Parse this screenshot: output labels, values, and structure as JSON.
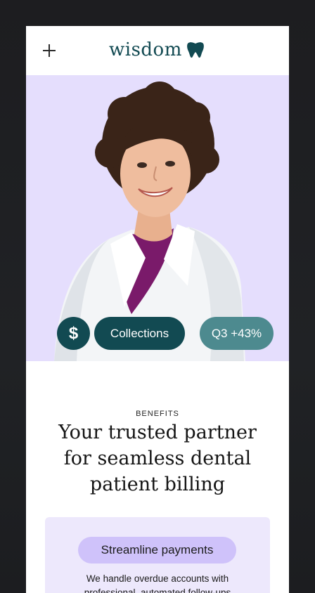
{
  "header": {
    "logo_text": "wisdom",
    "menu_icon": "plus-icon",
    "brand_color": "#124a52"
  },
  "hero": {
    "background": "#e5defd",
    "badge_icon_glyph": "$",
    "collections_label": "Collections",
    "stat_label": "Q3 +43%"
  },
  "section": {
    "eyebrow": "BENEFITS",
    "headline_line1": "Your trusted partner",
    "headline_line2": "for seamless dental",
    "headline_line3": "patient billing"
  },
  "card": {
    "pill_label": "Streamline payments",
    "body_line1": "We handle overdue accounts with",
    "body_line2": "professional, automated follow-ups"
  }
}
